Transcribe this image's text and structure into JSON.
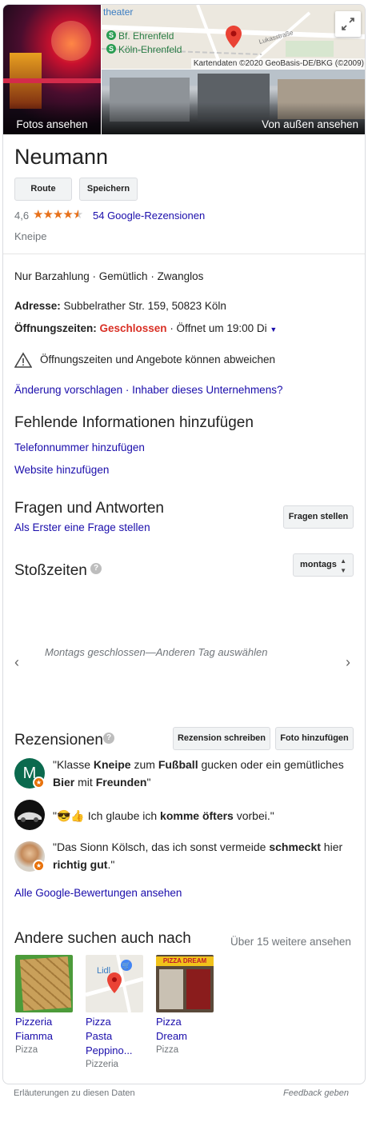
{
  "photos": {
    "left_caption": "Fotos ansehen",
    "right_caption": "Von außen ansehen"
  },
  "map": {
    "label_theater": "theater",
    "label_bf": "Bf. Ehrenfeld",
    "label_koeln": "Köln-Ehrenfeld",
    "label_street": "Lukasstraße",
    "copyright": "Kartendaten ©2020 GeoBasis-DE/BKG (©2009)"
  },
  "header": {
    "title": "Neumann",
    "route_label": "Route",
    "save_label": "Speichern",
    "rating": "4,6",
    "stars": 4.6,
    "reviews_link": "54 Google-Rezensionen",
    "category": "Kneipe"
  },
  "details": {
    "attributes": "Nur Barzahlung · Gemütlich · Zwanglos",
    "address_label": "Adresse:",
    "address_value": "Subbelrather Str. 159, 50823 Köln",
    "hours_label": "Öffnungszeiten:",
    "hours_status": "Geschlossen",
    "hours_next": " · Öffnet um 19:00 Di",
    "warning": "Öffnungszeiten und Angebote können abweichen",
    "suggest_edit": "Änderung vorschlagen",
    "sep": " · ",
    "owner": "Inhaber dieses Unternehmens?"
  },
  "missing": {
    "title": "Fehlende Informationen hinzufügen",
    "phone": "Telefonnummer hinzufügen",
    "website": "Website hinzufügen"
  },
  "qa": {
    "title": "Fragen und Antworten",
    "first": "Als Erster eine Frage stellen",
    "ask_button": "Fragen stellen"
  },
  "busy": {
    "title": "Stoßzeiten",
    "day_select": "montags",
    "closed_message": "Montags geschlossen—Anderen Tag auswählen"
  },
  "reviews": {
    "title": "Rezensionen",
    "write_button": "Rezension schreiben",
    "photo_button": "Foto hinzufügen",
    "items": [
      {
        "avatar_letter": "M",
        "avatar_color": "#0b6a4e",
        "pre": "\"Klasse ",
        "b1": "Kneipe",
        "m1": " zum ",
        "b2": "Fußball",
        "m2": " gucken oder ein gemütliches ",
        "b3": "Bier",
        "m3": " mit ",
        "b4": "Freunden",
        "post": "\""
      },
      {
        "pre": "\"",
        "emoji": "😎👍",
        "m1": " Ich glaube ich ",
        "b1": "komme öfters",
        "post": " vorbei.\""
      },
      {
        "pre": "\"Das Sionn Kölsch, das ich sonst vermeide ",
        "b1": "schmeckt",
        "m1": " hier ",
        "b2": "richtig gut",
        "post": ".\""
      }
    ],
    "all_link": "Alle Google-Bewertungen ansehen"
  },
  "others": {
    "title": "Andere suchen auch nach",
    "more": "Über 15 weitere ansehen",
    "items": [
      {
        "name": "Pizzeria Fiamma",
        "l1": "Pizzeria",
        "l2": "Fiamma",
        "type": "Pizza"
      },
      {
        "name": "Pizza Pasta Peppino...",
        "l1": "Pizza",
        "l2": "Pasta",
        "l3": "Peppino...",
        "type": "Pizzeria",
        "map_label": "Lidl"
      },
      {
        "name": "Pizza Dream",
        "l1": "Pizza",
        "l2": "Dream",
        "type": "Pizza",
        "sign": "PIZZA DREAM"
      }
    ]
  },
  "footer": {
    "explain": "Erläuterungen zu diesen Daten",
    "feedback": "Feedback geben"
  },
  "colors": {
    "link": "#1a0dab",
    "closed": "#d93025",
    "star": "#e7711b",
    "badge": "#e8710a"
  }
}
